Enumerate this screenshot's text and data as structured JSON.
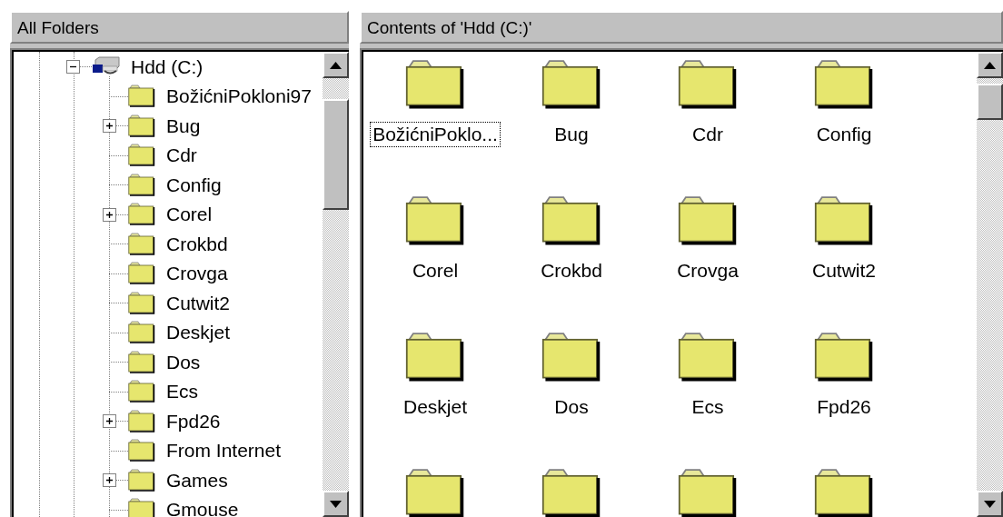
{
  "folders_pane": {
    "title": "All Folders",
    "tree": [
      {
        "label": "Hdd (C:)",
        "kind": "drive",
        "expanded": true,
        "children": [
          {
            "label": "BožićniPokloni97",
            "kind": "folder"
          },
          {
            "label": "Bug",
            "kind": "folder",
            "expanded": false
          },
          {
            "label": "Cdr",
            "kind": "folder"
          },
          {
            "label": "Config",
            "kind": "folder"
          },
          {
            "label": "Corel",
            "kind": "folder",
            "expanded": false
          },
          {
            "label": "Crokbd",
            "kind": "folder"
          },
          {
            "label": "Crovga",
            "kind": "folder"
          },
          {
            "label": "Cutwit2",
            "kind": "folder"
          },
          {
            "label": "Deskjet",
            "kind": "folder"
          },
          {
            "label": "Dos",
            "kind": "folder"
          },
          {
            "label": "Ecs",
            "kind": "folder"
          },
          {
            "label": "Fpd26",
            "kind": "folder",
            "expanded": false
          },
          {
            "label": "From Internet",
            "kind": "folder"
          },
          {
            "label": "Games",
            "kind": "folder",
            "expanded": false
          },
          {
            "label": "Gmouse",
            "kind": "folder"
          }
        ]
      }
    ]
  },
  "contents_pane": {
    "title": "Contents of 'Hdd (C:)'",
    "items": [
      {
        "name": "BožićniPoklo...",
        "focused": true
      },
      {
        "name": "Bug",
        "focused": false
      },
      {
        "name": "Cdr",
        "focused": false
      },
      {
        "name": "Config",
        "focused": false
      },
      {
        "name": "Corel",
        "focused": false
      },
      {
        "name": "Crokbd",
        "focused": false
      },
      {
        "name": "Crovga",
        "focused": false
      },
      {
        "name": "Cutwit2",
        "focused": false
      },
      {
        "name": "Deskjet",
        "focused": false
      },
      {
        "name": "Dos",
        "focused": false
      },
      {
        "name": "Ecs",
        "focused": false
      },
      {
        "name": "Fpd26",
        "focused": false
      },
      {
        "focused": false
      },
      {
        "focused": false
      },
      {
        "focused": false
      },
      {
        "focused": false
      }
    ]
  }
}
